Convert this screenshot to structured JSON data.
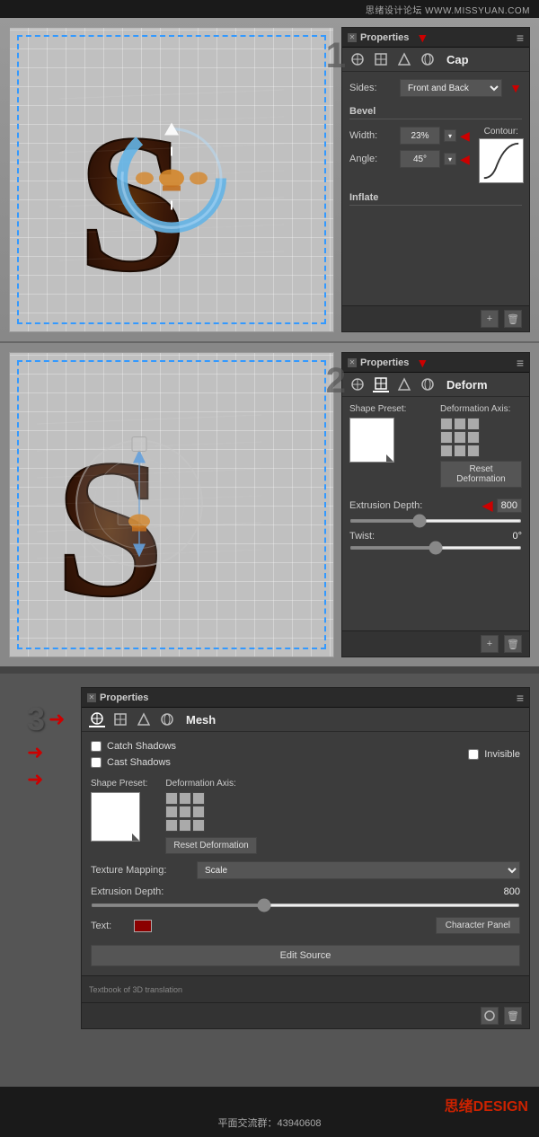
{
  "watermark": {
    "text": "思绪设计论坛  WWW.MISSYUAN.COM"
  },
  "section1": {
    "step_number": "1",
    "panel": {
      "title": "Properties",
      "tab_label": "Cap",
      "sides_label": "Sides:",
      "sides_value": "Front and Back",
      "bevel_label": "Bevel",
      "width_label": "Width:",
      "width_value": "23%",
      "contour_label": "Contour:",
      "angle_label": "Angle:",
      "angle_value": "45°",
      "inflate_label": "Inflate"
    }
  },
  "section2": {
    "step_number": "2",
    "panel": {
      "title": "Properties",
      "tab_label": "Deform",
      "shape_preset_label": "Shape Preset:",
      "deformation_axis_label": "Deformation Axis:",
      "reset_btn": "Reset Deformation",
      "extrusion_depth_label": "Extrusion Depth:",
      "extrusion_depth_value": "800",
      "twist_label": "Twist:",
      "twist_value": "0°"
    }
  },
  "section3": {
    "step_number": "3",
    "panel": {
      "title": "Properties",
      "tab_label": "Mesh",
      "catch_shadows_label": "Catch Shadows",
      "cast_shadows_label": "Cast Shadows",
      "invisible_label": "Invisible",
      "shape_preset_label": "Shape Preset:",
      "deformation_axis_label": "Deformation Axis:",
      "reset_btn": "Reset Deformation",
      "texture_mapping_label": "Texture Mapping:",
      "texture_mapping_value": "Scale",
      "extrusion_depth_label": "Extrusion Depth:",
      "extrusion_depth_value": "800",
      "text_label": "Text:",
      "character_panel_btn": "Character Panel",
      "edit_source_btn": "Edit Source",
      "bottom_bar_text": "Textbook of 3D translation"
    }
  },
  "footer": {
    "brand": "思绪DESIGN",
    "qq": "平面交流群：43940608"
  },
  "icons": {
    "close": "✕",
    "menu": "≡",
    "mesh_icon": "⬡",
    "deform_icon": "⬡",
    "cap_icon": "⬡",
    "arrow_right": "▶",
    "arrow_left": "◀",
    "plus_icon": "+",
    "trash_icon": "🗑",
    "refresh_icon": "↺",
    "chevron_down": "▾",
    "arrow_down": "↓",
    "arrow_up": "↑"
  }
}
